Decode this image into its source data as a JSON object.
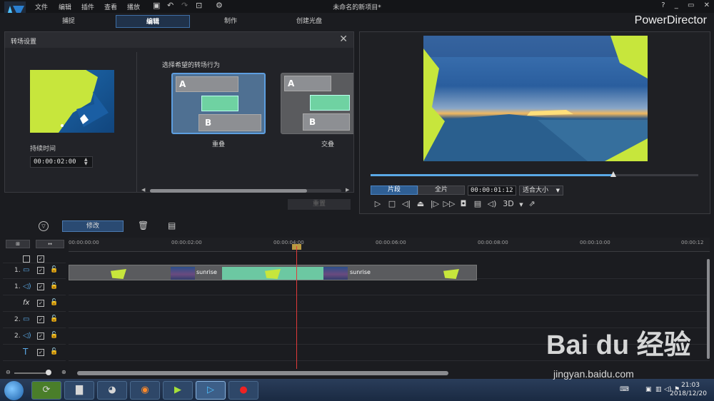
{
  "menubar": {
    "items": [
      "文件",
      "编辑",
      "插件",
      "查看",
      "播放"
    ],
    "title": "未命名的新项目*",
    "window_controls": [
      "?",
      "_",
      "▭",
      "✕"
    ]
  },
  "modes": {
    "tabs": [
      "捕捉",
      "编辑",
      "制作",
      "创建光盘"
    ],
    "active": "编辑",
    "brand": "PowerDirector"
  },
  "transition_panel": {
    "title": "转场设置",
    "duration_label": "持续时间",
    "duration_value": "00:00:02:00",
    "choose_label": "选择希望的转场行为",
    "options": [
      {
        "label": "重叠",
        "a": "A",
        "b": "B",
        "selected": true
      },
      {
        "label": "交叠",
        "a": "A",
        "b": "B",
        "selected": false
      }
    ],
    "apply_label": "重置"
  },
  "preview": {
    "segment_label": "片段",
    "full_label": "全片",
    "timecode": "00:00:01:12",
    "fit_label": "适合大小",
    "progress": 0.74,
    "controls_3d": "3D"
  },
  "toolbar": {
    "modify_label": "修改"
  },
  "timeline": {
    "ruler_ticks": [
      "00:00:00:00",
      "00:00:02:00",
      "00:00:04:00",
      "00:00:06:00",
      "00:00:08:00",
      "00:00:10:00",
      "00:00:12"
    ],
    "tracks": [
      {
        "num": "1.",
        "kind": "video"
      },
      {
        "num": "1.",
        "kind": "audio"
      },
      {
        "num": "",
        "kind": "fx",
        "icon": "fx"
      },
      {
        "num": "2.",
        "kind": "video"
      },
      {
        "num": "2.",
        "kind": "audio"
      },
      {
        "num": "",
        "kind": "title",
        "icon": "T"
      }
    ],
    "clips": [
      {
        "label": "sunrise"
      },
      {
        "label": "sunrise"
      }
    ]
  },
  "taskbar": {
    "time": "21:03",
    "date": "2018/12/20"
  },
  "watermark": {
    "main": "Bai du 经验",
    "url": "jingyan.baidu.com"
  }
}
